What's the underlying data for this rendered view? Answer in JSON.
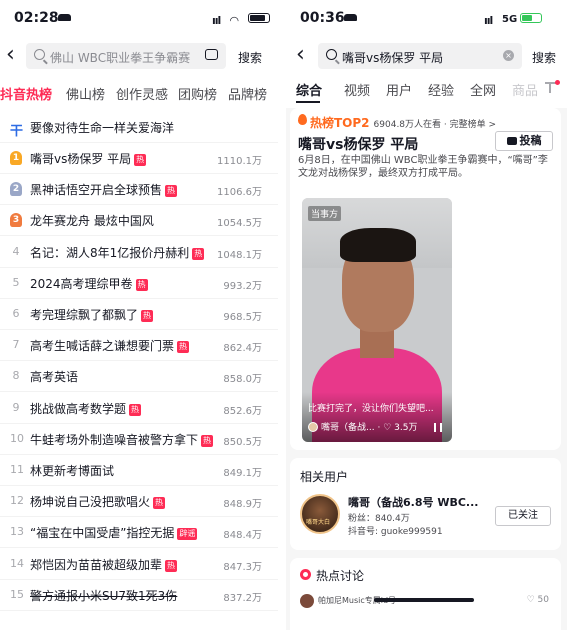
{
  "left": {
    "status": {
      "time": "02:28"
    },
    "search": {
      "query": "佛山 WBC职业拳王争霸赛",
      "button": "搜索"
    },
    "tabs": [
      {
        "label": "抖音热榜",
        "active": true
      },
      {
        "label": "佛山榜",
        "active": false
      },
      {
        "label": "创作灵感",
        "active": false
      },
      {
        "label": "团购榜",
        "active": false
      },
      {
        "label": "品牌榜",
        "active": false
      }
    ],
    "pinned": {
      "rank": "干",
      "title": "要像对待生命一样关爱海洋"
    },
    "hot_list": [
      {
        "rank": "1",
        "title": "嘴哥vs杨保罗 平局",
        "tag": "热",
        "heat": "1110.1万"
      },
      {
        "rank": "2",
        "title": "黑神话悟空开启全球预售",
        "tag": "热",
        "heat": "1106.6万"
      },
      {
        "rank": "3",
        "title": "龙年赛龙舟 最炫中国风",
        "tag": "",
        "heat": "1054.5万"
      },
      {
        "rank": "4",
        "title": "名记：湖人8年1亿报价丹赫利",
        "tag": "热",
        "heat": "1048.1万"
      },
      {
        "rank": "5",
        "title": "2024高考理综甲卷",
        "tag": "热",
        "heat": "993.2万"
      },
      {
        "rank": "6",
        "title": "考完理综飘了都飘了",
        "tag": "热",
        "heat": "968.5万"
      },
      {
        "rank": "7",
        "title": "高考生喊话薛之谦想要门票",
        "tag": "热",
        "heat": "862.4万"
      },
      {
        "rank": "8",
        "title": "高考英语",
        "tag": "",
        "heat": "858.0万"
      },
      {
        "rank": "9",
        "title": "挑战做高考数学题",
        "tag": "热",
        "heat": "852.6万"
      },
      {
        "rank": "10",
        "title": "牛蛙考场外制造噪音被警方拿下",
        "tag": "热",
        "heat": "850.5万"
      },
      {
        "rank": "11",
        "title": "林更新考博面试",
        "tag": "",
        "heat": "849.1万"
      },
      {
        "rank": "12",
        "title": "杨坤说自己没把歌唱火",
        "tag": "热",
        "heat": "848.9万"
      },
      {
        "rank": "13",
        "title": "“福宝在中国受虐”指控无据",
        "tag": "辟谣",
        "heat": "848.4万"
      },
      {
        "rank": "14",
        "title": "郑恺因为苗苗被超级加辈",
        "tag": "热",
        "heat": "847.3万"
      },
      {
        "rank": "15",
        "title": "警方通报小米SU7致1死3伤",
        "tag": "",
        "heat": "837.2万"
      }
    ]
  },
  "right": {
    "status": {
      "time": "00:36",
      "network": "5G"
    },
    "search": {
      "query": "嘴哥vs杨保罗 平局",
      "button": "搜索"
    },
    "tabs": [
      {
        "label": "综合",
        "active": true
      },
      {
        "label": "视频",
        "active": false
      },
      {
        "label": "用户",
        "active": false
      },
      {
        "label": "经验",
        "active": false
      },
      {
        "label": "全网",
        "active": false
      },
      {
        "label": "商品",
        "active": false
      }
    ],
    "hot_card": {
      "rank_label": "热榜TOP2",
      "meta": "6904.8万人在看 · 完整榜单 >",
      "title": "嘴哥vs杨保罗 平局",
      "post_button": "投稿",
      "description": "6月8日，在中国佛山 WBC职业拳王争霸赛中，“嘴哥”李文龙对战杨保罗，最终双方打成平局。",
      "video": {
        "source_label": "当事方",
        "caption": "比赛打完了，没让你们失望吧...",
        "author": "嘴哥（备战...",
        "likes": "3.5万"
      }
    },
    "related_users": {
      "title": "相关用户",
      "user": {
        "avatar_text": "嘴哥大白",
        "name": "嘴哥（备战6.8号 WBC...",
        "fans": "粉丝：840.4万",
        "douyin_id": "抖音号: guoke999591",
        "follow_button": "已关注"
      }
    },
    "discussion": {
      "title": "热点讨论",
      "comment_user": "帕加尼Music专属id号",
      "likes": "50"
    }
  }
}
